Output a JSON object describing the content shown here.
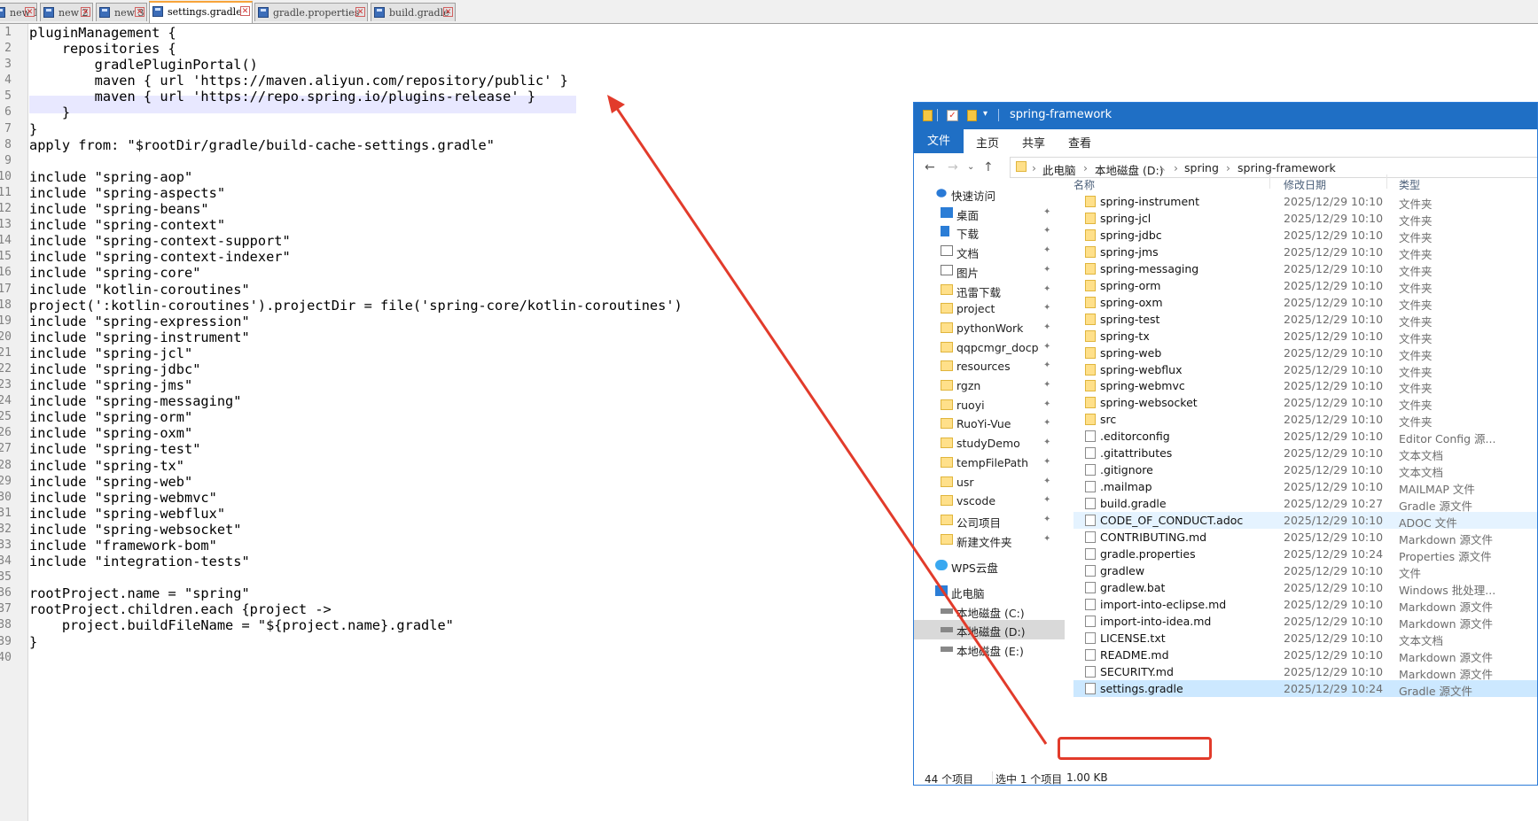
{
  "editor": {
    "tabs": [
      {
        "label": "new 1",
        "active": false
      },
      {
        "label": "new 2",
        "active": false
      },
      {
        "label": "new 3",
        "active": false
      },
      {
        "label": "settings.gradle",
        "active": true
      },
      {
        "label": "gradle.properties",
        "active": false
      },
      {
        "label": "build.gradle",
        "active": false
      }
    ],
    "line_numbers": [
      "1",
      "2",
      "3",
      "4",
      "5",
      "6",
      "7",
      "8",
      "9",
      "10",
      "11",
      "12",
      "13",
      "14",
      "15",
      "16",
      "17",
      "18",
      "19",
      "20",
      "21",
      "22",
      "23",
      "24",
      "25",
      "26",
      "27",
      "28",
      "29",
      "30",
      "31",
      "32",
      "33",
      "34",
      "35",
      "36",
      "37",
      "38",
      "39",
      "40"
    ],
    "lines": [
      "pluginManagement {",
      "    repositories {",
      "        gradlePluginPortal()",
      "        maven { url 'https://maven.aliyun.com/repository/public' }",
      "        maven { url 'https://repo.spring.io/plugins-release' }",
      "    }",
      "}",
      "apply from: \"$rootDir/gradle/build-cache-settings.gradle\"",
      "",
      "include \"spring-aop\"",
      "include \"spring-aspects\"",
      "include \"spring-beans\"",
      "include \"spring-context\"",
      "include \"spring-context-support\"",
      "include \"spring-context-indexer\"",
      "include \"spring-core\"",
      "include \"kotlin-coroutines\"",
      "project(':kotlin-coroutines').projectDir = file('spring-core/kotlin-coroutines')",
      "include \"spring-expression\"",
      "include \"spring-instrument\"",
      "include \"spring-jcl\"",
      "include \"spring-jdbc\"",
      "include \"spring-jms\"",
      "include \"spring-messaging\"",
      "include \"spring-orm\"",
      "include \"spring-oxm\"",
      "include \"spring-test\"",
      "include \"spring-tx\"",
      "include \"spring-web\"",
      "include \"spring-webmvc\"",
      "include \"spring-webflux\"",
      "include \"spring-websocket\"",
      "include \"framework-bom\"",
      "include \"integration-tests\"",
      "",
      "rootProject.name = \"spring\"",
      "rootProject.children.each {project ->",
      "    project.buildFileName = \"${project.name}.gradle\"",
      "}",
      ""
    ]
  },
  "explorer": {
    "title": "spring-framework",
    "ribbon_tabs": [
      "文件",
      "主页",
      "共享",
      "查看"
    ],
    "breadcrumb": [
      "此电脑",
      "本地磁盘 (D:)",
      "spring",
      "spring-framework"
    ],
    "nav_items": [
      {
        "label": "快速访问",
        "icon": "star-icon",
        "pinned": false
      },
      {
        "label": "桌面",
        "icon": "desktop-icon",
        "pinned": true
      },
      {
        "label": "下载",
        "icon": "download-icon",
        "pinned": true
      },
      {
        "label": "文档",
        "icon": "document-icon",
        "pinned": true
      },
      {
        "label": "图片",
        "icon": "picture-icon",
        "pinned": true
      },
      {
        "label": "迅雷下载",
        "icon": "folder-icon",
        "pinned": true
      },
      {
        "label": "project",
        "icon": "folder-icon",
        "pinned": true
      },
      {
        "label": "pythonWork",
        "icon": "folder-icon",
        "pinned": true
      },
      {
        "label": "qqpcmgr_docp",
        "icon": "folder-icon",
        "pinned": true
      },
      {
        "label": "resources",
        "icon": "folder-icon",
        "pinned": true
      },
      {
        "label": "rgzn",
        "icon": "folder-icon",
        "pinned": true
      },
      {
        "label": "ruoyi",
        "icon": "folder-icon",
        "pinned": true
      },
      {
        "label": "RuoYi-Vue",
        "icon": "folder-icon",
        "pinned": true
      },
      {
        "label": "studyDemo",
        "icon": "folder-icon",
        "pinned": true
      },
      {
        "label": "tempFilePath",
        "icon": "folder-icon",
        "pinned": true
      },
      {
        "label": "usr",
        "icon": "folder-icon",
        "pinned": true
      },
      {
        "label": "vscode",
        "icon": "folder-icon",
        "pinned": true
      },
      {
        "label": "公司项目",
        "icon": "folder-icon",
        "pinned": true
      },
      {
        "label": "新建文件夹",
        "icon": "folder-icon",
        "pinned": true
      },
      {
        "label": "WPS云盘",
        "icon": "cloud-icon",
        "pinned": false
      },
      {
        "label": "此电脑",
        "icon": "computer-icon",
        "pinned": false
      },
      {
        "label": "本地磁盘 (C:)",
        "icon": "drive-icon",
        "pinned": false
      },
      {
        "label": "本地磁盘 (D:)",
        "icon": "drive-icon",
        "pinned": false
      },
      {
        "label": "本地磁盘 (E:)",
        "icon": "drive-icon",
        "pinned": false
      }
    ],
    "columns": [
      "名称",
      "修改日期",
      "类型"
    ],
    "files": [
      {
        "name": "spring-instrument",
        "date": "2025/12/29 10:10",
        "type": "文件夹",
        "kind": "folder"
      },
      {
        "name": "spring-jcl",
        "date": "2025/12/29 10:10",
        "type": "文件夹",
        "kind": "folder"
      },
      {
        "name": "spring-jdbc",
        "date": "2025/12/29 10:10",
        "type": "文件夹",
        "kind": "folder"
      },
      {
        "name": "spring-jms",
        "date": "2025/12/29 10:10",
        "type": "文件夹",
        "kind": "folder"
      },
      {
        "name": "spring-messaging",
        "date": "2025/12/29 10:10",
        "type": "文件夹",
        "kind": "folder"
      },
      {
        "name": "spring-orm",
        "date": "2025/12/29 10:10",
        "type": "文件夹",
        "kind": "folder"
      },
      {
        "name": "spring-oxm",
        "date": "2025/12/29 10:10",
        "type": "文件夹",
        "kind": "folder"
      },
      {
        "name": "spring-test",
        "date": "2025/12/29 10:10",
        "type": "文件夹",
        "kind": "folder"
      },
      {
        "name": "spring-tx",
        "date": "2025/12/29 10:10",
        "type": "文件夹",
        "kind": "folder"
      },
      {
        "name": "spring-web",
        "date": "2025/12/29 10:10",
        "type": "文件夹",
        "kind": "folder"
      },
      {
        "name": "spring-webflux",
        "date": "2025/12/29 10:10",
        "type": "文件夹",
        "kind": "folder"
      },
      {
        "name": "spring-webmvc",
        "date": "2025/12/29 10:10",
        "type": "文件夹",
        "kind": "folder"
      },
      {
        "name": "spring-websocket",
        "date": "2025/12/29 10:10",
        "type": "文件夹",
        "kind": "folder"
      },
      {
        "name": "src",
        "date": "2025/12/29 10:10",
        "type": "文件夹",
        "kind": "folder"
      },
      {
        "name": ".editorconfig",
        "date": "2025/12/29 10:10",
        "type": "Editor Config 源...",
        "kind": "file"
      },
      {
        "name": ".gitattributes",
        "date": "2025/12/29 10:10",
        "type": "文本文档",
        "kind": "file"
      },
      {
        "name": ".gitignore",
        "date": "2025/12/29 10:10",
        "type": "文本文档",
        "kind": "file"
      },
      {
        "name": ".mailmap",
        "date": "2025/12/29 10:10",
        "type": "MAILMAP 文件",
        "kind": "file"
      },
      {
        "name": "build.gradle",
        "date": "2025/12/29 10:27",
        "type": "Gradle 源文件",
        "kind": "file"
      },
      {
        "name": "CODE_OF_CONDUCT.adoc",
        "date": "2025/12/29 10:10",
        "type": "ADOC 文件",
        "kind": "file"
      },
      {
        "name": "CONTRIBUTING.md",
        "date": "2025/12/29 10:10",
        "type": "Markdown 源文件",
        "kind": "file"
      },
      {
        "name": "gradle.properties",
        "date": "2025/12/29 10:24",
        "type": "Properties 源文件",
        "kind": "file"
      },
      {
        "name": "gradlew",
        "date": "2025/12/29 10:10",
        "type": "文件",
        "kind": "file"
      },
      {
        "name": "gradlew.bat",
        "date": "2025/12/29 10:10",
        "type": "Windows 批处理...",
        "kind": "file"
      },
      {
        "name": "import-into-eclipse.md",
        "date": "2025/12/29 10:10",
        "type": "Markdown 源文件",
        "kind": "file"
      },
      {
        "name": "import-into-idea.md",
        "date": "2025/12/29 10:10",
        "type": "Markdown 源文件",
        "kind": "file"
      },
      {
        "name": "LICENSE.txt",
        "date": "2025/12/29 10:10",
        "type": "文本文档",
        "kind": "file"
      },
      {
        "name": "README.md",
        "date": "2025/12/29 10:10",
        "type": "Markdown 源文件",
        "kind": "file"
      },
      {
        "name": "SECURITY.md",
        "date": "2025/12/29 10:10",
        "type": "Markdown 源文件",
        "kind": "file"
      },
      {
        "name": "settings.gradle",
        "date": "2025/12/29 10:24",
        "type": "Gradle 源文件",
        "kind": "file"
      }
    ],
    "status": {
      "count": "44 个项目",
      "selected": "选中 1 个项目",
      "size": "1.00 KB"
    }
  },
  "colors": {
    "accent": "#1f6fc5",
    "annotation": "#e23b2b",
    "line_highlight": "#e8e8ff"
  }
}
